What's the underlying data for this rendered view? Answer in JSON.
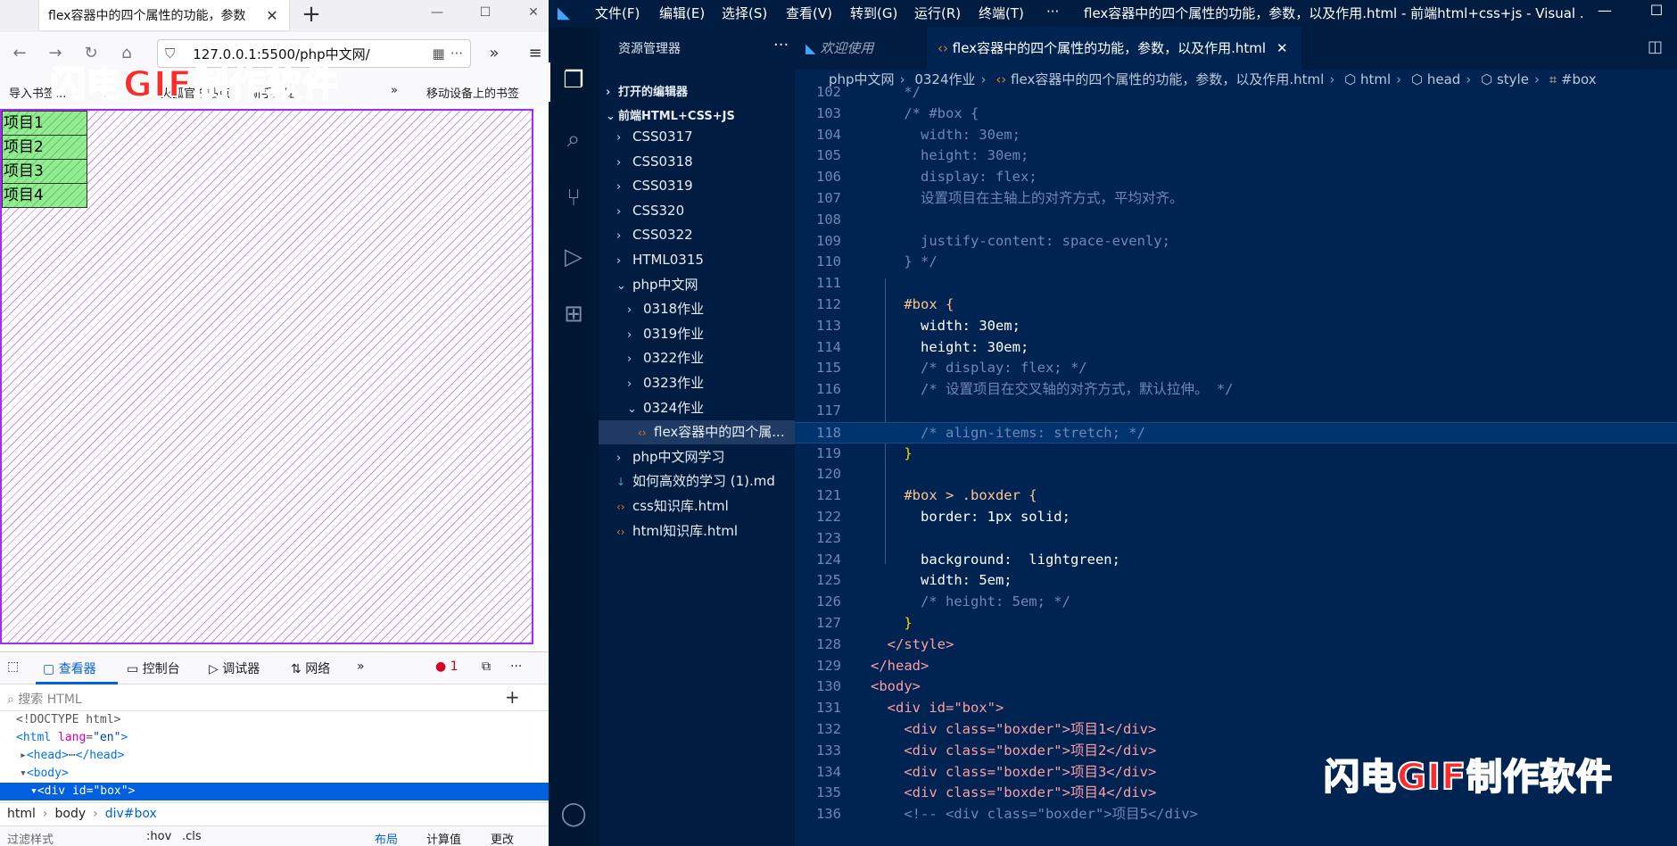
{
  "firefox": {
    "tab_title": "flex容器中的四个属性的功能，参数",
    "url": "127.0.0.1:5500/php中文网/",
    "bookmarks": [
      "导入书签...",
      "火狐官方站点",
      "新手上路",
      "移动设备上的书签"
    ],
    "preview_items": [
      "项目1",
      "项目2",
      "项目3",
      "项目4"
    ],
    "devtools": {
      "tabs": [
        "查看器",
        "控制台",
        "调试器",
        "网络"
      ],
      "error_count": "1",
      "search_placeholder": "搜索 HTML",
      "tree": {
        "doctype": "<!DOCTYPE html>",
        "html_open": "<html",
        "lang_attr": "lang",
        "lang_val": "\"en\"",
        "head": "<head>",
        "head_ellipsis": "⋯",
        "head_close": "</head>",
        "body": "<body>",
        "div_open": "<div",
        "id_attr": "id",
        "id_val": "\"box\"",
        "div_close": ">"
      },
      "breadcrumb": [
        "html",
        "body",
        "div#box"
      ],
      "bottom": {
        "filter": "过滤样式",
        "hov": ":hov",
        "cls": ".cls",
        "layout": "布局",
        "computed": "计算值",
        "changes": "更改"
      }
    }
  },
  "watermark": {
    "part1": "闪电GIF",
    "part2": "制作软件"
  },
  "vscode": {
    "menus": [
      "文件(F)",
      "编辑(E)",
      "选择(S)",
      "查看(V)",
      "转到(G)",
      "运行(R)",
      "终端(T)",
      "···"
    ],
    "window_title": "flex容器中的四个属性的功能，参数，以及作用.html - 前端html+css+js - Visual ...",
    "sidebar": {
      "header": "资源管理器",
      "open_editors": "打开的编辑器",
      "workspace": "前端HTML+CSS+JS",
      "items": [
        {
          "label": "CSS0317",
          "indent": 1,
          "kind": "folder-closed"
        },
        {
          "label": "CSS0318",
          "indent": 1,
          "kind": "folder-closed"
        },
        {
          "label": "CSS0319",
          "indent": 1,
          "kind": "folder-closed"
        },
        {
          "label": "CSS320",
          "indent": 1,
          "kind": "folder-closed"
        },
        {
          "label": "CSS0322",
          "indent": 1,
          "kind": "folder-closed"
        },
        {
          "label": "HTML0315",
          "indent": 1,
          "kind": "folder-closed"
        },
        {
          "label": "php中文网",
          "indent": 1,
          "kind": "folder-open"
        },
        {
          "label": "0318作业",
          "indent": 2,
          "kind": "folder-closed"
        },
        {
          "label": "0319作业",
          "indent": 2,
          "kind": "folder-closed"
        },
        {
          "label": "0322作业",
          "indent": 2,
          "kind": "folder-closed"
        },
        {
          "label": "0323作业",
          "indent": 2,
          "kind": "folder-closed"
        },
        {
          "label": "0324作业",
          "indent": 2,
          "kind": "folder-open"
        },
        {
          "label": "flex容器中的四个属...",
          "indent": 3,
          "kind": "html",
          "selected": true
        },
        {
          "label": "php中文网学习",
          "indent": 1,
          "kind": "folder-closed"
        },
        {
          "label": "如何高效的学习 (1).md",
          "indent": 1,
          "kind": "md"
        },
        {
          "label": "css知识库.html",
          "indent": 1,
          "kind": "html"
        },
        {
          "label": "html知识库.html",
          "indent": 1,
          "kind": "html"
        }
      ]
    },
    "tabs": [
      {
        "label": "欢迎使用",
        "active": false
      },
      {
        "label": "flex容器中的四个属性的功能，参数，以及作用.html",
        "active": true
      }
    ],
    "breadcrumb": [
      "php中文网",
      "0324作业",
      "flex容器中的四个属性的功能，参数，以及作用.html",
      "html",
      "head",
      "style",
      "#box"
    ],
    "lines": [
      {
        "n": "102",
        "t": "    */",
        "cls": "c-cm"
      },
      {
        "n": "103",
        "t": "    /* #box {",
        "cls": "c-cm"
      },
      {
        "n": "104",
        "t": "      width: 30em;",
        "cls": "c-cm"
      },
      {
        "n": "105",
        "t": "      height: 30em;",
        "cls": "c-cm"
      },
      {
        "n": "106",
        "t": "      display: flex;",
        "cls": "c-cm"
      },
      {
        "n": "107",
        "t": "      设置项目在主轴上的对齐方式，平均对齐。",
        "cls": "c-cm"
      },
      {
        "n": "108",
        "t": "",
        "cls": "c-cm"
      },
      {
        "n": "109",
        "t": "      justify-content: space-evenly;",
        "cls": "c-cm"
      },
      {
        "n": "110",
        "t": "    } */",
        "cls": "c-cm"
      },
      {
        "n": "111",
        "t": "",
        "cls": ""
      },
      {
        "n": "112",
        "t": "    #box {",
        "cls": "c-sel"
      },
      {
        "n": "113",
        "t": "      width: 30em;",
        "cls": "c-prop"
      },
      {
        "n": "114",
        "t": "      height: 30em;",
        "cls": "c-prop"
      },
      {
        "n": "115",
        "t": "      /* display: flex; */",
        "cls": "c-cm"
      },
      {
        "n": "116",
        "t": "      /* 设置项目在交叉轴的对齐方式，默认拉伸。 */",
        "cls": "c-cm"
      },
      {
        "n": "117",
        "t": "",
        "cls": ""
      },
      {
        "n": "118",
        "t": "      /* align-items: stretch; */",
        "cls": "c-cm"
      },
      {
        "n": "119",
        "t": "    }",
        "cls": "c-br"
      },
      {
        "n": "120",
        "t": "",
        "cls": ""
      },
      {
        "n": "121",
        "t": "    #box > .boxder {",
        "cls": "c-sel"
      },
      {
        "n": "122",
        "t": "      border: 1px solid;",
        "cls": "c-prop"
      },
      {
        "n": "123",
        "t": "",
        "cls": ""
      },
      {
        "n": "124",
        "t": "      background:  lightgreen;",
        "cls": "c-prop"
      },
      {
        "n": "125",
        "t": "      width: 5em;",
        "cls": "c-prop"
      },
      {
        "n": "126",
        "t": "      /* height: 5em; */",
        "cls": "c-cm"
      },
      {
        "n": "127",
        "t": "    }",
        "cls": "c-br"
      },
      {
        "n": "128",
        "t": "  </style>",
        "cls": "c-tag"
      },
      {
        "n": "129",
        "t": "</head>",
        "cls": "c-tag"
      },
      {
        "n": "130",
        "t": "<body>",
        "cls": "c-tag"
      },
      {
        "n": "131",
        "t": "  <div id=\"box\">",
        "cls": "c-tag"
      },
      {
        "n": "132",
        "t": "    <div class=\"boxder\">项目1</div>",
        "cls": "c-tag"
      },
      {
        "n": "133",
        "t": "    <div class=\"boxder\">项目2</div>",
        "cls": "c-tag"
      },
      {
        "n": "134",
        "t": "    <div class=\"boxder\">项目3</div>",
        "cls": "c-tag"
      },
      {
        "n": "135",
        "t": "    <div class=\"boxder\">项目4</div>",
        "cls": "c-tag"
      },
      {
        "n": "136",
        "t": "    <!-- <div class=\"boxder\">项目5</div>",
        "cls": "c-cm"
      }
    ]
  }
}
